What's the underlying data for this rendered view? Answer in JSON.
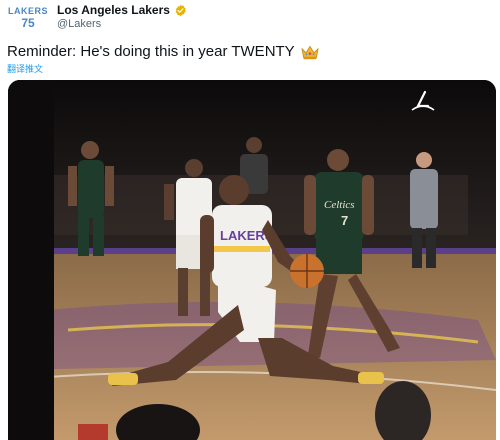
{
  "tweet": {
    "avatar": {
      "line1": "LAKERS",
      "line2": "75"
    },
    "display_name": "Los Angeles Lakers",
    "handle": "@Lakers",
    "text": "Reminder: He's doing this in year TWENTY",
    "translate_label": "翻译推文"
  },
  "media": {
    "type": "video-still",
    "jersey_text_main": "LAKERS",
    "jersey_text_opponent": "Celtics",
    "opponent_number": "7"
  },
  "colors": {
    "lakers_blue": "#4a86c5",
    "verified_gold": "#e8b300",
    "link_blue": "#1d9bf0",
    "jersey_white": "#f2f0ec",
    "jersey_purple": "#6a3fa0",
    "celtics_green": "#1f3b2c",
    "court_wood": "#b08a60"
  },
  "icons": {
    "verified": "verified-badge-icon",
    "crown": "crown-emoji-icon",
    "brand": "lakers-brand-logo"
  }
}
